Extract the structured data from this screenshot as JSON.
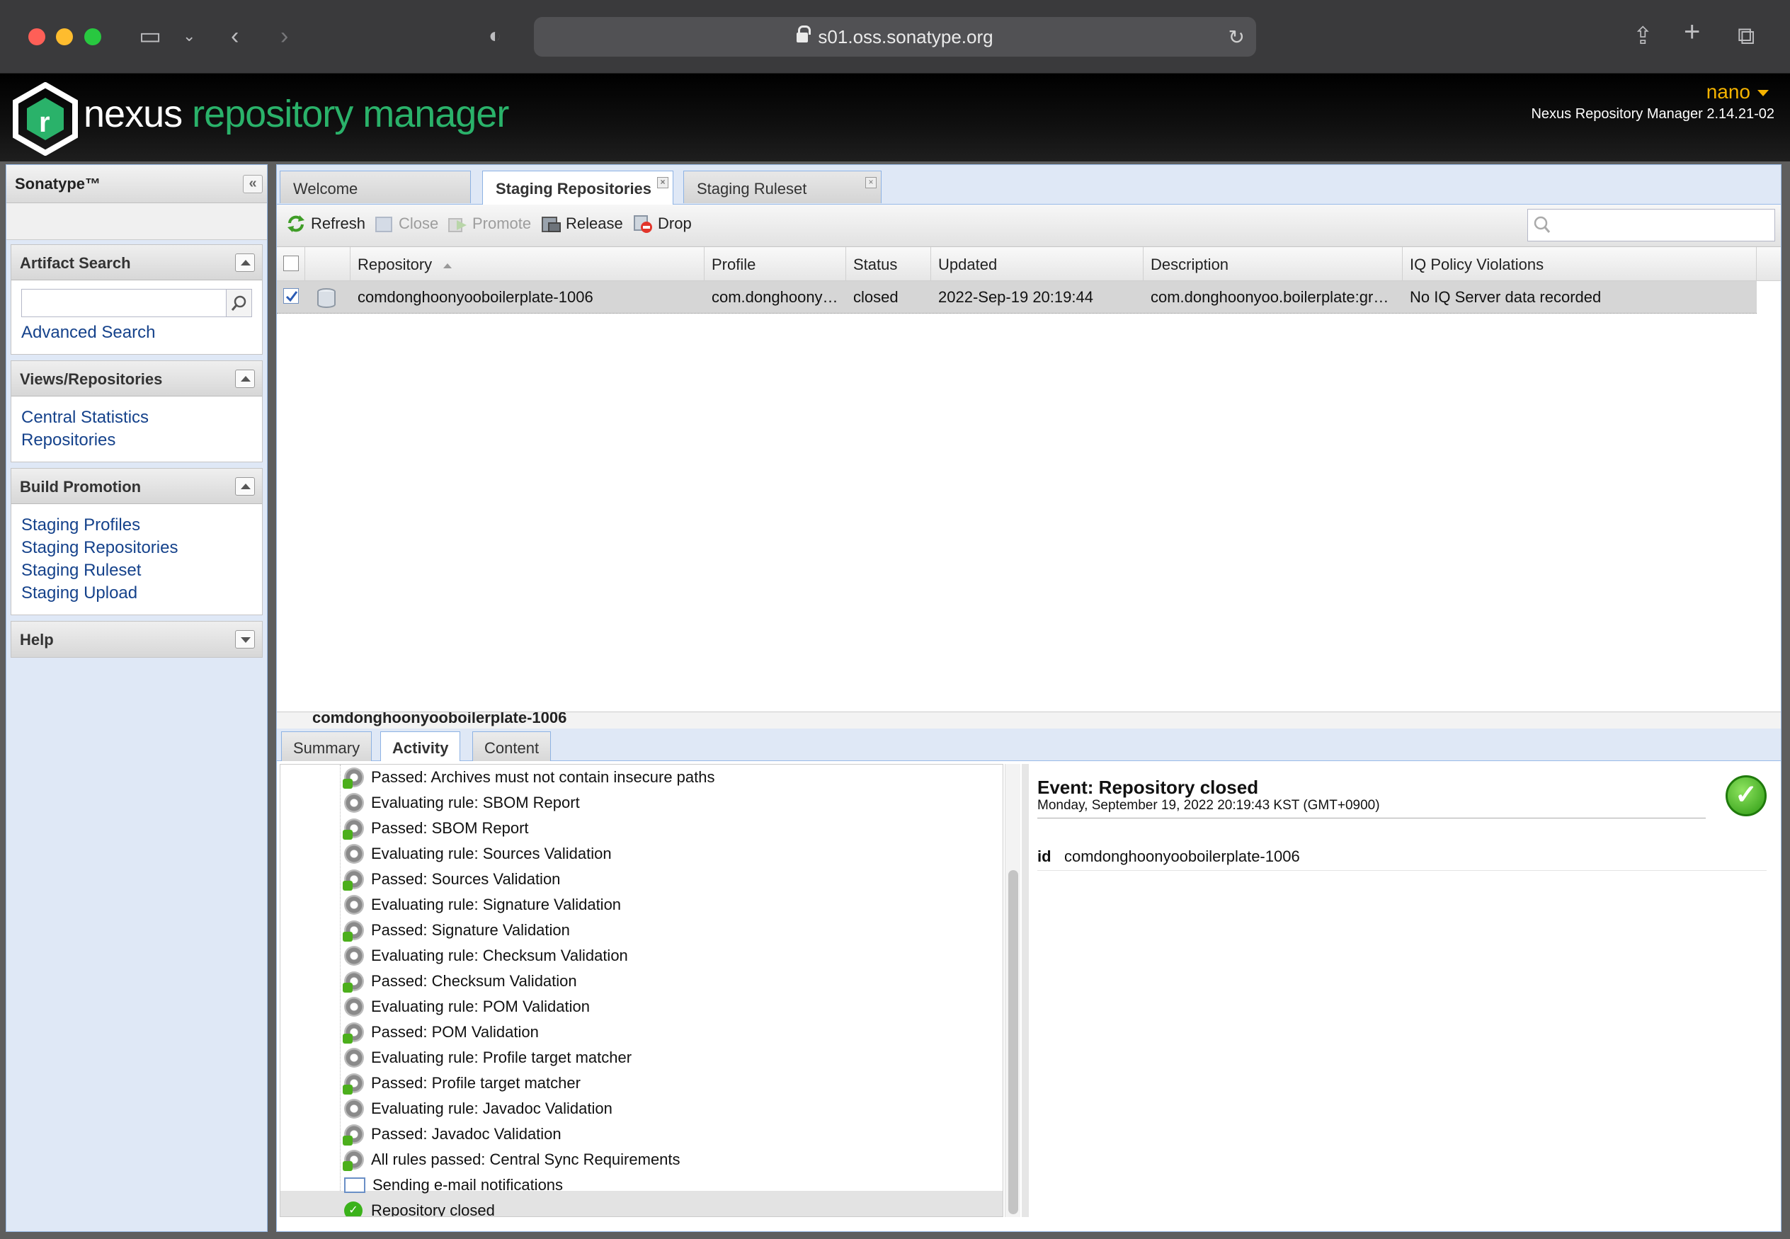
{
  "browser": {
    "url": "s01.oss.sonatype.org"
  },
  "header": {
    "logo_word_1": "nexus",
    "logo_word_2": "repository manager",
    "user": "nano",
    "version": "Nexus Repository Manager 2.14.21-02"
  },
  "left": {
    "title": "Sonatype™",
    "artifact_search": {
      "title": "Artifact Search",
      "link": "Advanced Search"
    },
    "views": {
      "title": "Views/Repositories",
      "links": [
        "Central Statistics",
        "Repositories"
      ]
    },
    "build": {
      "title": "Build Promotion",
      "links": [
        "Staging Profiles",
        "Staging Repositories",
        "Staging Ruleset",
        "Staging Upload"
      ]
    },
    "help": {
      "title": "Help"
    }
  },
  "tabs": [
    "Welcome",
    "Staging Repositories",
    "Staging Ruleset"
  ],
  "toolbar": {
    "refresh": "Refresh",
    "close": "Close",
    "promote": "Promote",
    "release": "Release",
    "drop": "Drop"
  },
  "grid": {
    "columns": [
      "Repository",
      "Profile",
      "Status",
      "Updated",
      "Description",
      "IQ Policy Violations"
    ],
    "rows": [
      {
        "repository": "comdonghoonyooboilerplate-1006",
        "profile": "com.donghoony…",
        "status": "closed",
        "updated": "2022-Sep-19 20:19:44",
        "description": "com.donghoonyoo.boilerplate:gr…",
        "iq": "No IQ Server data recorded"
      }
    ]
  },
  "lower": {
    "title": "comdonghoonyooboilerplate-1006",
    "subtabs": [
      "Summary",
      "Activity",
      "Content"
    ],
    "activity": [
      "Passed: Archives must not contain insecure paths",
      "Evaluating rule: SBOM Report",
      "Passed: SBOM Report",
      "Evaluating rule: Sources Validation",
      "Passed: Sources Validation",
      "Evaluating rule: Signature Validation",
      "Passed: Signature Validation",
      "Evaluating rule: Checksum Validation",
      "Passed: Checksum Validation",
      "Evaluating rule: POM Validation",
      "Passed: POM Validation",
      "Evaluating rule: Profile target matcher",
      "Passed: Profile target matcher",
      "Evaluating rule: Javadoc Validation",
      "Passed: Javadoc Validation",
      "All rules passed: Central Sync Requirements",
      "Sending e-mail notifications",
      "Repository closed"
    ],
    "event": {
      "title": "Event: Repository closed",
      "date": "Monday, September 19, 2022 20:19:43 KST (GMT+0900)",
      "key": "id",
      "value": "comdonghoonyooboilerplate-1006"
    }
  }
}
